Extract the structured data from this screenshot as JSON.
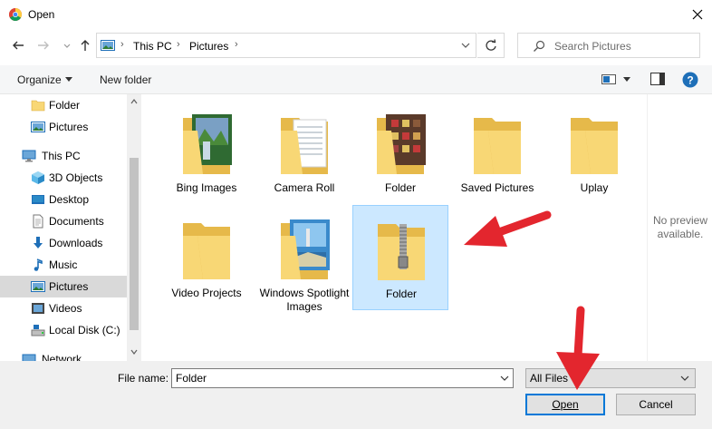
{
  "window": {
    "title": "Open",
    "app_icon": "chrome-icon",
    "close_icon": "close-icon"
  },
  "navigation": {
    "back_icon": "back-arrow-icon",
    "forward_icon": "forward-arrow-icon",
    "recent_icon": "chevron-down-icon",
    "up_icon": "up-arrow-icon",
    "breadcrumbs": [
      "This PC",
      "Pictures"
    ],
    "refresh_icon": "refresh-icon",
    "search_placeholder": "Search Pictures"
  },
  "toolbar": {
    "organize_label": "Organize",
    "new_folder_label": "New folder",
    "view_icon": "view-options-icon",
    "preview_pane_icon": "preview-pane-icon",
    "help_icon": "help-icon"
  },
  "sidebar": {
    "items": [
      {
        "label": "Folder",
        "icon": "folder-icon"
      },
      {
        "label": "Pictures",
        "icon": "pictures-icon"
      },
      {
        "label": "This PC",
        "icon": "computer-icon"
      },
      {
        "label": "3D Objects",
        "icon": "cube-icon"
      },
      {
        "label": "Desktop",
        "icon": "desktop-icon"
      },
      {
        "label": "Documents",
        "icon": "document-icon"
      },
      {
        "label": "Downloads",
        "icon": "download-icon"
      },
      {
        "label": "Music",
        "icon": "music-icon"
      },
      {
        "label": "Pictures",
        "icon": "pictures-icon",
        "selected": true
      },
      {
        "label": "Videos",
        "icon": "video-icon"
      },
      {
        "label": "Local Disk (C:)",
        "icon": "drive-icon"
      },
      {
        "label": "Network",
        "icon": "network-icon"
      }
    ]
  },
  "files": [
    {
      "name": "Bing Images",
      "kind": "photo-folder"
    },
    {
      "name": "Camera Roll",
      "kind": "doc-folder"
    },
    {
      "name": "Folder",
      "kind": "photo-folder"
    },
    {
      "name": "Saved Pictures",
      "kind": "folder"
    },
    {
      "name": "Uplay",
      "kind": "folder"
    },
    {
      "name": "Video Projects",
      "kind": "folder"
    },
    {
      "name": "Windows Spotlight Images",
      "kind": "photo-folder"
    },
    {
      "name": "Folder",
      "kind": "zip-folder",
      "selected": true
    }
  ],
  "preview": {
    "text": "No preview available."
  },
  "footer": {
    "file_name_label": "File name:",
    "file_name_value": "Folder",
    "file_type_value": "All Files",
    "open_label": "Open",
    "cancel_label": "Cancel"
  },
  "colors": {
    "selection": "#cce8ff",
    "accent": "#0078d7",
    "annotation_arrow": "#e3262e",
    "folder": "#f8d775"
  }
}
